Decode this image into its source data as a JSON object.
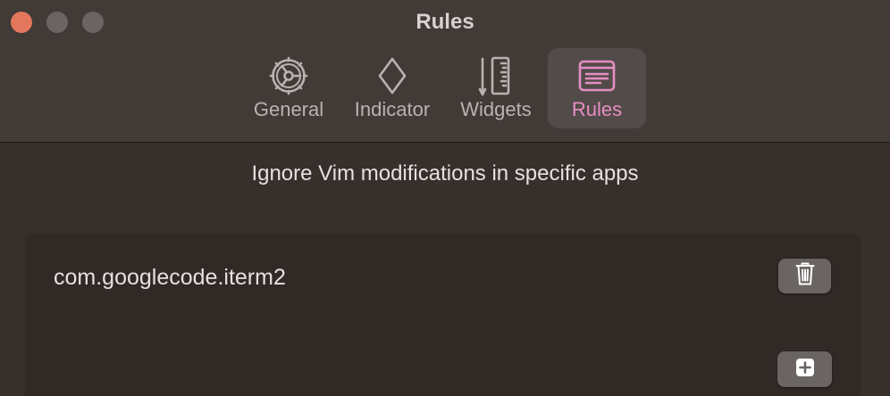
{
  "window": {
    "title": "Rules"
  },
  "toolbar": {
    "tabs": [
      {
        "label": "General",
        "icon": "steering-wheel-icon"
      },
      {
        "label": "Indicator",
        "icon": "diamond-icon"
      },
      {
        "label": "Widgets",
        "icon": "widgets-ruler-icon"
      },
      {
        "label": "Rules",
        "icon": "window-list-icon",
        "selected": true
      }
    ]
  },
  "main": {
    "heading": "Ignore Vim modifications in specific apps",
    "rules": [
      {
        "bundle_id": "com.googlecode.iterm2"
      }
    ],
    "delete_icon": "trash-icon",
    "add_icon": "plus-icon"
  },
  "colors": {
    "accent": "#e58ec2",
    "close": "#e3775d",
    "button": "#6a6462"
  }
}
